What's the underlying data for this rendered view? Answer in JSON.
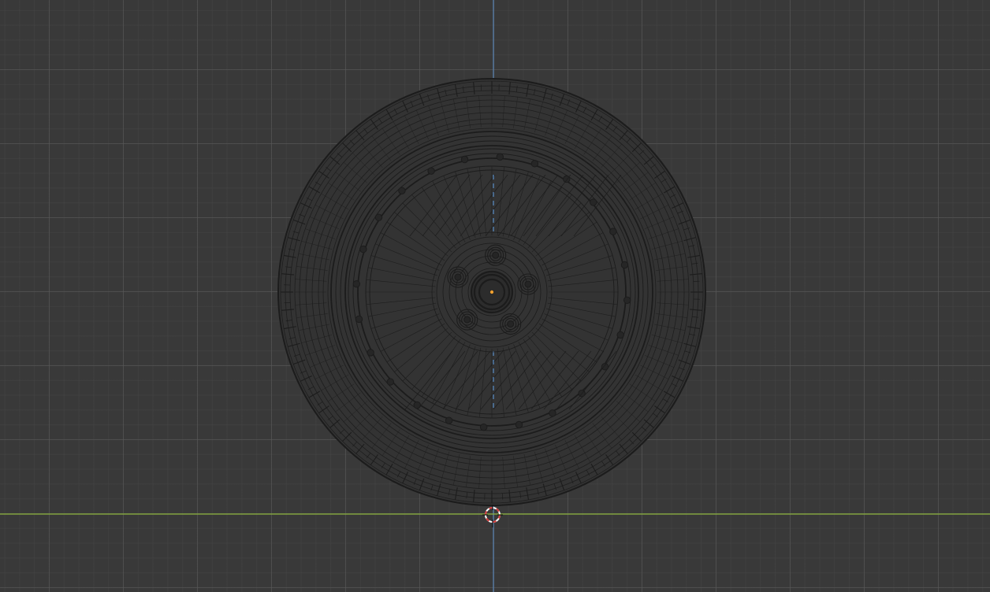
{
  "viewport": {
    "view": "front-orthographic",
    "colors": {
      "background": "#393939",
      "grid_major": "#4a4a4a",
      "grid_minor": "#404040",
      "x_axis": "#8cb33c",
      "z_axis": "#5b8fc9",
      "wireframe": "#1c1c1c",
      "origin_dot": "#f0a030",
      "cursor_red": "#d63a3a",
      "cursor_white": "#ffffff"
    },
    "objects": [
      {
        "name": "wheel",
        "type": "mesh",
        "display": "wireframe",
        "lug_nuts": 5,
        "rim_bolts": 24
      }
    ],
    "cursor": {
      "type": "3d-cursor-icon"
    }
  }
}
